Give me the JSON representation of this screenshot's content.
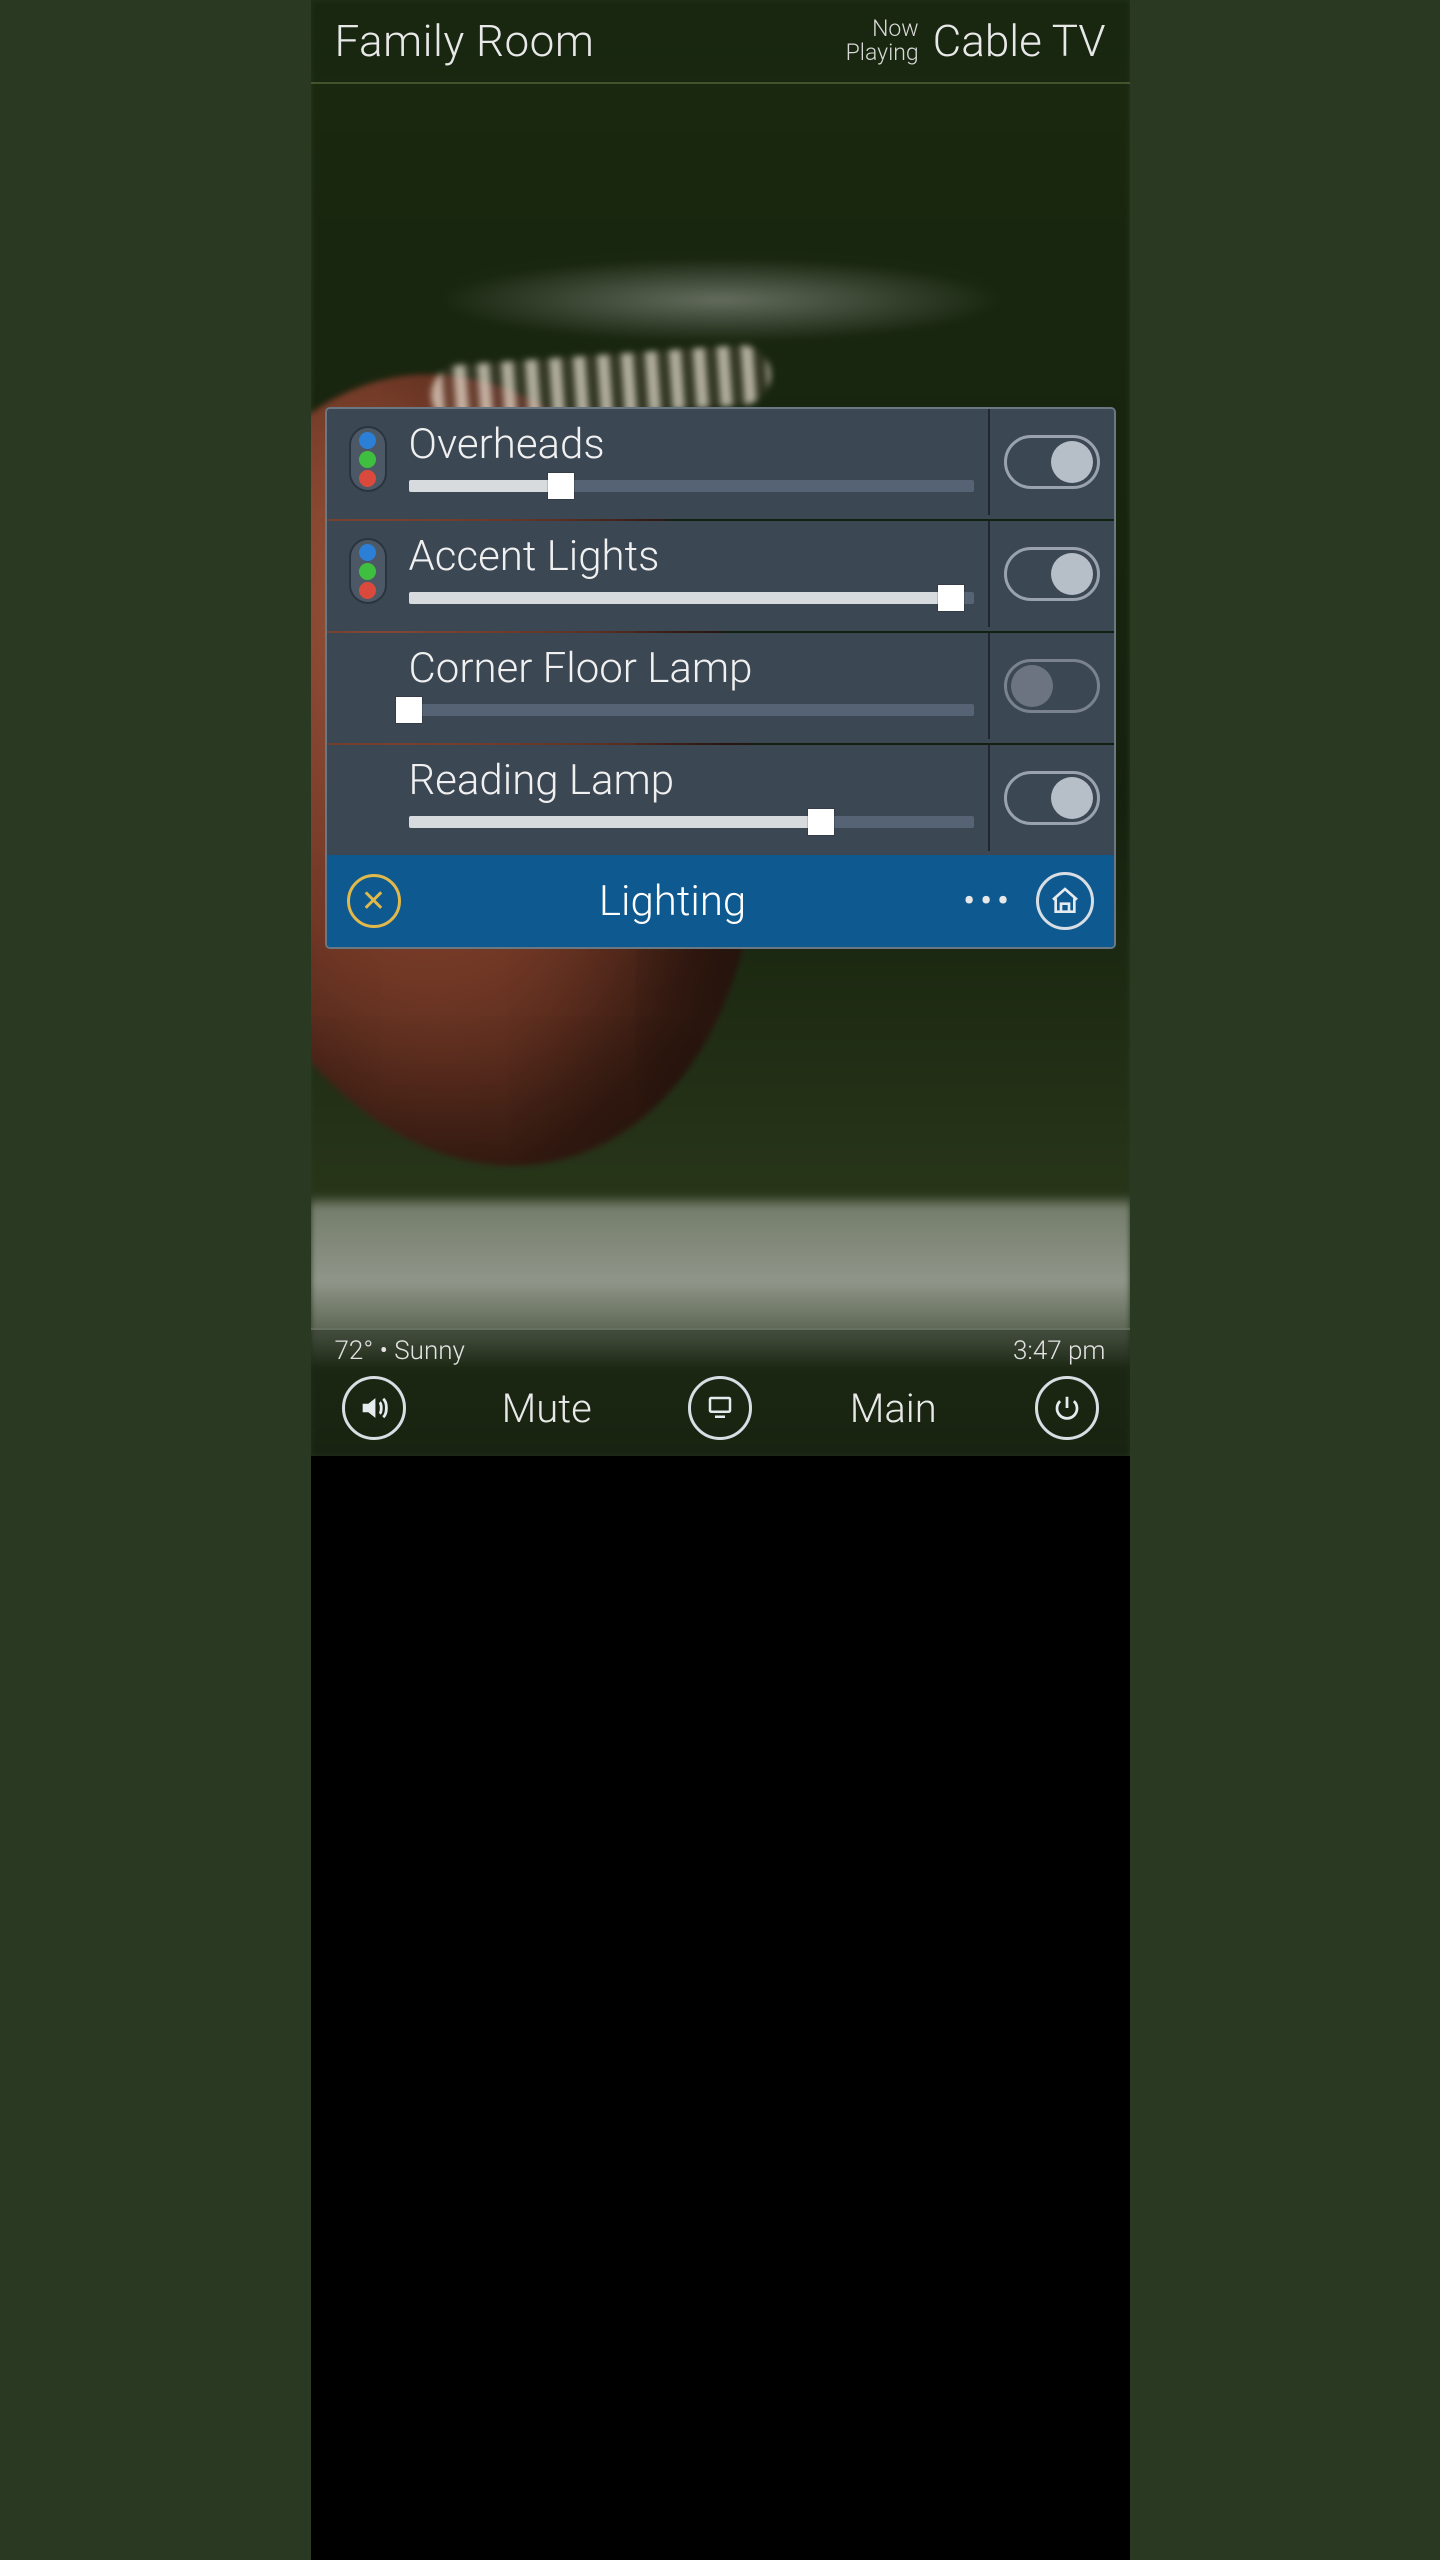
{
  "header": {
    "room": "Family Room",
    "now_playing_label_line1": "Now",
    "now_playing_label_line2": "Playing",
    "source": "Cable TV"
  },
  "panel": {
    "title": "Lighting",
    "lights": [
      {
        "name": "Overheads",
        "has_rgb": true,
        "level_pct": 27,
        "on": true
      },
      {
        "name": "Accent Lights",
        "has_rgb": true,
        "level_pct": 96,
        "on": true
      },
      {
        "name": "Corner Floor Lamp",
        "has_rgb": false,
        "level_pct": 0,
        "on": false
      },
      {
        "name": "Reading Lamp",
        "has_rgb": false,
        "level_pct": 73,
        "on": true
      }
    ]
  },
  "footer": {
    "weather": "72° • Sunny",
    "time": "3:47 pm",
    "mute_label": "Mute",
    "main_label": "Main"
  },
  "icons": {
    "close_glyph": "✕",
    "more_glyph": "•••"
  }
}
